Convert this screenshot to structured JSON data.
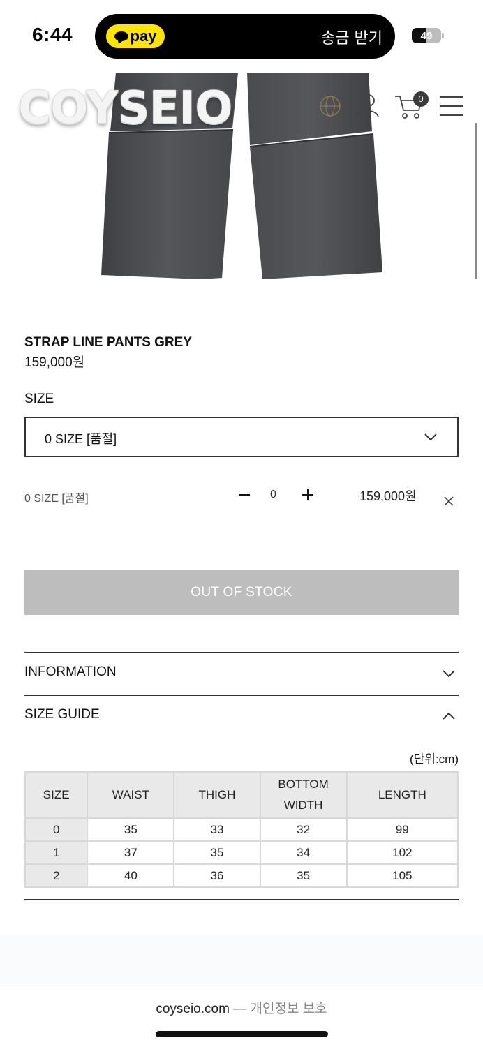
{
  "status_bar": {
    "time": "6:44",
    "pay_label": "pay",
    "send_label": "송금 받기",
    "battery": "49"
  },
  "brand": {
    "logo_text": "COYSEIO",
    "cart_count": "0"
  },
  "product": {
    "name": "STRAP LINE PANTS GREY",
    "price": "159,000원",
    "size_label": "SIZE",
    "selected_size": "0 SIZE [품절]"
  },
  "option": {
    "name": "0 SIZE [품절]",
    "quantity": "0",
    "price": "159,000원"
  },
  "actions": {
    "out_of_stock": "OUT OF STOCK"
  },
  "sections": {
    "information": "INFORMATION",
    "size_guide": "SIZE GUIDE"
  },
  "size_guide": {
    "unit": "(단위:cm)",
    "headers": [
      "SIZE",
      "WAIST",
      "THIGH",
      "BOTTOM WIDTH",
      "LENGTH"
    ],
    "rows": [
      [
        "0",
        "35",
        "33",
        "32",
        "99"
      ],
      [
        "1",
        "37",
        "35",
        "34",
        "102"
      ],
      [
        "2",
        "40",
        "36",
        "35",
        "105"
      ]
    ]
  },
  "footer": {
    "domain": "coyseio.com",
    "separator": "—",
    "privacy": "개인정보 보호"
  },
  "colors": {
    "pay_yellow": "#ffe600",
    "button_grey": "#bdbdbd",
    "pants_grey": "#4d4e52"
  }
}
